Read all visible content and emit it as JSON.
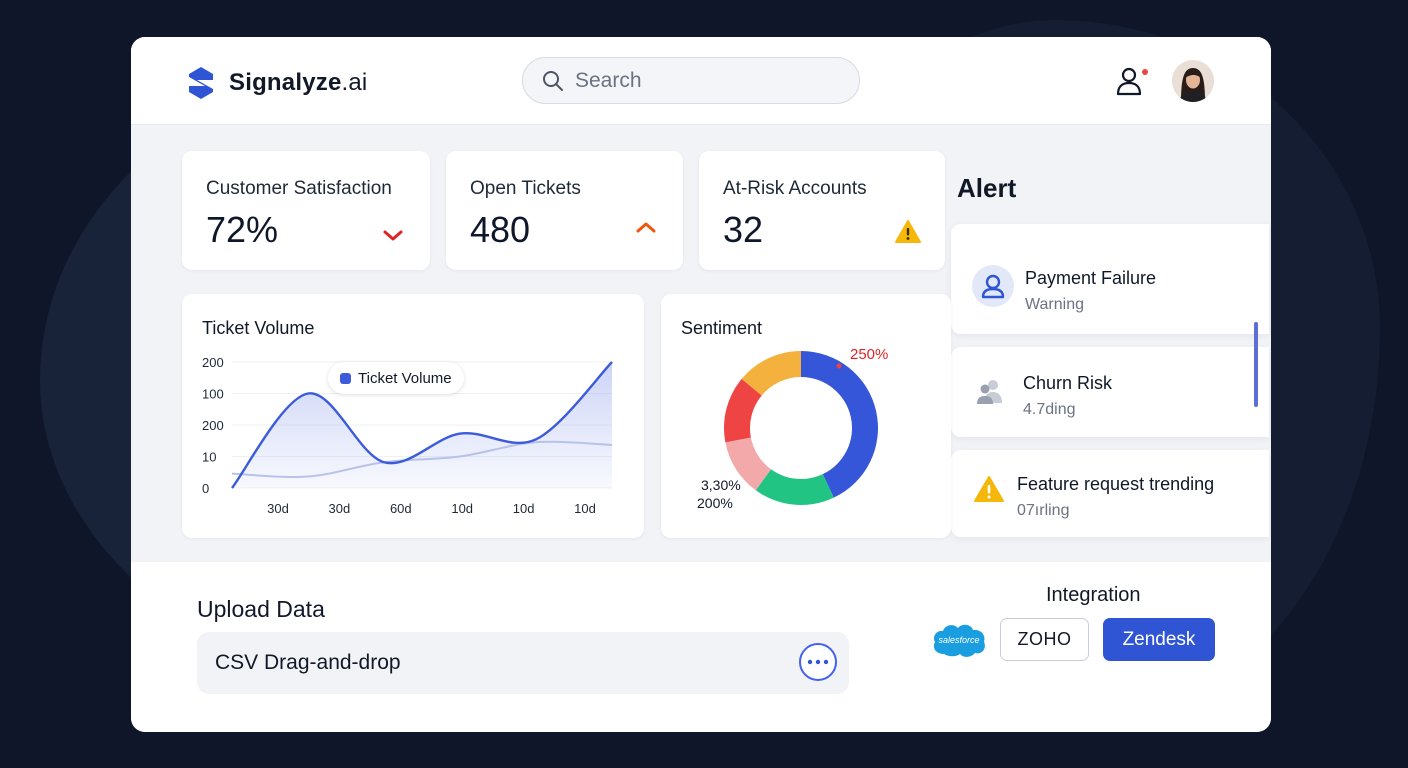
{
  "brand": {
    "name": "Signalyze",
    "suffix": ".ai"
  },
  "search": {
    "placeholder": "Search"
  },
  "header": {
    "user_icon": "user-icon",
    "avatar_icon": "avatar"
  },
  "kpis": [
    {
      "label": "Customer Satisfaction",
      "value": "72%",
      "icon": "chevron-down-icon",
      "color": "#dc2626"
    },
    {
      "label": "Open Tickets",
      "value": "480",
      "icon": "chevron-up-icon",
      "color": "#ea580c"
    },
    {
      "label": "At-Risk Accounts",
      "value": "32",
      "icon": "warning-icon",
      "color": "#f5b70a"
    }
  ],
  "alerts": {
    "title": "Alert",
    "items": [
      {
        "name": "Payment Failure",
        "sub": "Warning",
        "icon": "user-icon"
      },
      {
        "name": "Churn Risk",
        "sub": "4.7ding",
        "icon": "users-icon"
      },
      {
        "name": "Feature request trending",
        "sub": "07ırling",
        "icon": "warning-icon"
      }
    ]
  },
  "ticket_volume": {
    "title": "Ticket Volume",
    "legend": "Ticket Volume",
    "series_color": "#3b5bdb"
  },
  "sentiment": {
    "title": "Sentiment",
    "label_top": "250%",
    "label_bottom_1": "3,30%",
    "label_bottom_2": "200%"
  },
  "upload": {
    "title": "Upload Data",
    "dropzone_label": "CSV Drag-and-drop"
  },
  "integration": {
    "title": "Integration",
    "salesforce": "salesforce",
    "zoho": "ZOHO",
    "zendesk": "Zendesk"
  },
  "chart_data": [
    {
      "type": "line",
      "title": "Ticket Volume",
      "y_tick_labels": [
        "200",
        "100",
        "200",
        "10",
        "0"
      ],
      "x_tick_labels": [
        "30d",
        "30d",
        "60d",
        "10d",
        "10d",
        "10d"
      ],
      "series": [
        {
          "name": "Ticket Volume",
          "values": [
            0,
            165,
            45,
            95,
            85,
            220
          ]
        }
      ],
      "secondary_line_values": [
        25,
        20,
        45,
        55,
        80,
        75
      ],
      "legend": "top-center"
    },
    {
      "type": "pie",
      "title": "Sentiment",
      "slices": [
        {
          "color": "#3556d8",
          "value": 43
        },
        {
          "color": "#22c483",
          "value": 17
        },
        {
          "color": "#f3a9a9",
          "value": 12
        },
        {
          "color": "#ef4444",
          "value": 14
        },
        {
          "color": "#f5b13d",
          "value": 14
        }
      ],
      "labels": [
        "250%",
        "3,30%",
        "200%"
      ]
    }
  ]
}
